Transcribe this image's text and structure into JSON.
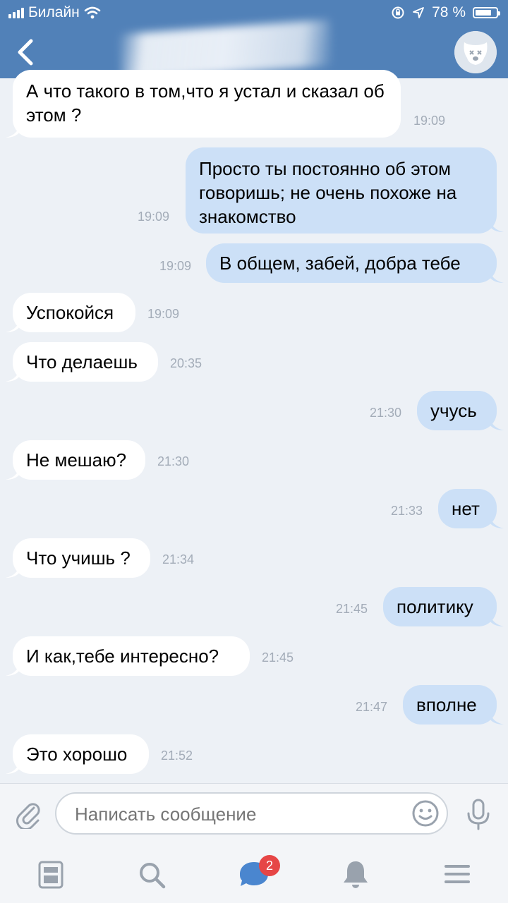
{
  "status_bar": {
    "carrier": "Билайн",
    "battery_text": "78 %",
    "battery_level": 0.78
  },
  "header": {
    "title_obscured": true,
    "avatar_icon": "dog-avatar-icon"
  },
  "messages": [
    {
      "dir": "in",
      "text": "А что такого в том,что я устал и сказал об этом ?",
      "time": "19:09"
    },
    {
      "dir": "out",
      "text": "Просто ты постоянно об этом говоришь; не очень похоже на знакомство",
      "time": "19:09"
    },
    {
      "dir": "out",
      "text": "В общем, забей, добра тебе",
      "time": "19:09"
    },
    {
      "dir": "in",
      "text": "Успокойся",
      "time": "19:09"
    },
    {
      "dir": "in",
      "text": "Что делаешь",
      "time": "20:35"
    },
    {
      "dir": "out",
      "text": "учусь",
      "time": "21:30"
    },
    {
      "dir": "in",
      "text": "Не мешаю?",
      "time": "21:30"
    },
    {
      "dir": "out",
      "text": "нет",
      "time": "21:33"
    },
    {
      "dir": "in",
      "text": "Что учишь ?",
      "time": "21:34"
    },
    {
      "dir": "out",
      "text": "политику",
      "time": "21:45"
    },
    {
      "dir": "in",
      "text": "И как,тебе интересно?",
      "time": "21:45"
    },
    {
      "dir": "out",
      "text": "вполне",
      "time": "21:47"
    },
    {
      "dir": "in",
      "text": "Это хорошо",
      "time": "21:52"
    }
  ],
  "composer": {
    "placeholder": "Написать сообщение"
  },
  "tabbar": {
    "messages_badge": "2"
  },
  "colors": {
    "header": "#5181b8",
    "background": "#edf1f6",
    "incoming_bubble": "#ffffff",
    "outgoing_bubble": "#cce0f7",
    "badge": "#e64646"
  }
}
